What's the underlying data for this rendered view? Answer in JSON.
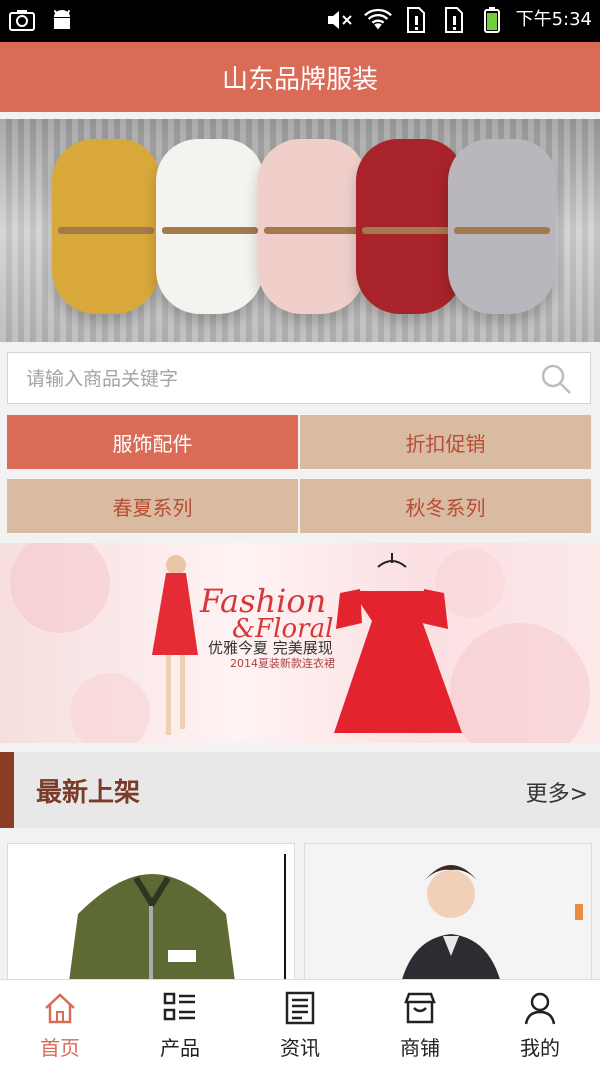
{
  "status_bar": {
    "time": "下午5:34",
    "left_icons": [
      "screenshot-icon",
      "android-icon"
    ],
    "right_icons": [
      "mute-icon",
      "wifi-icon",
      "sim1-icon",
      "sim2-icon",
      "battery-icon"
    ]
  },
  "app_bar": {
    "title": "山东品牌服装"
  },
  "search": {
    "placeholder": "请输入商品关键字",
    "icon": "search-icon"
  },
  "categories": [
    {
      "label": "服饰配件",
      "active": true
    },
    {
      "label": "折扣促销",
      "active": false
    },
    {
      "label": "春夏系列",
      "active": false
    },
    {
      "label": "秋冬系列",
      "active": false
    }
  ],
  "promo_banner": {
    "fashion_text": "Fashion",
    "floral_text": "&Floral",
    "slogan": "优雅今夏 完美展现",
    "subline": "2014夏装新款连衣裙"
  },
  "section": {
    "title": "最新上架",
    "more": "更多>"
  },
  "tab_bar": [
    {
      "label": "首页",
      "icon": "home-icon",
      "active": true
    },
    {
      "label": "产品",
      "icon": "grid-list-icon",
      "active": false
    },
    {
      "label": "资讯",
      "icon": "news-icon",
      "active": false
    },
    {
      "label": "商铺",
      "icon": "store-icon",
      "active": false
    },
    {
      "label": "我的",
      "icon": "user-icon",
      "active": false
    }
  ],
  "colors": {
    "accent": "#d96b57",
    "category_inactive_bg": "#d9bba1",
    "category_inactive_text": "#b64e36",
    "section_bar": "#8c3b25"
  }
}
